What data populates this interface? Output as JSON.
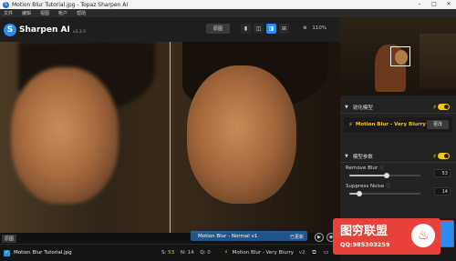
{
  "window": {
    "title": "Motion Blur Tutorial.jpg - Topaz Sharpen AI",
    "controls": [
      "–",
      "□",
      "✕"
    ]
  },
  "menu": [
    "文件",
    "编辑",
    "视图",
    "帐户",
    "帮助"
  ],
  "toolbar": {
    "app_name": "Sharpen AI",
    "version": "v3.3.5",
    "compare_label": "原图",
    "view_icons": [
      "▮",
      "◫",
      "◨",
      "⊞"
    ],
    "zoom_label": "110%",
    "zoom_icon": "⊕"
  },
  "preview": {
    "original_label": "原图",
    "right_model_label": "Motion Blur - Normal v1",
    "right_status": "已更新",
    "controls": [
      "▶",
      "◉"
    ]
  },
  "statusbar": {
    "filename": "Motion Blur Tutorial.jpg",
    "s_label": "S:",
    "s_value": "53",
    "n_label": "N:",
    "n_value": "14",
    "q_label": "Q:",
    "q_value": "0",
    "model_name": "Motion Blur - Very Blurry",
    "model_version": "v2",
    "icons": [
      "⧉",
      "▭",
      "▣"
    ]
  },
  "sidebar": {
    "model_section": {
      "title": "锐化模型",
      "model_name": "Motion Blur - Very Blurry",
      "change_label": "更改",
      "enabled": true
    },
    "params_section": {
      "title": "模型参数",
      "enabled": true,
      "params": [
        {
          "label": "Remove Blur",
          "value": "53",
          "level": 53
        },
        {
          "label": "Suppress Noise",
          "value": "14",
          "level": 14
        }
      ]
    }
  },
  "watermark": {
    "title": "图穷联盟",
    "qq": "QQ:985303259",
    "logo_glyph": "♨"
  },
  "colors": {
    "accent": "#2d8cf0",
    "bolt": "#f5c518",
    "watermark_red": "#e8413a"
  }
}
